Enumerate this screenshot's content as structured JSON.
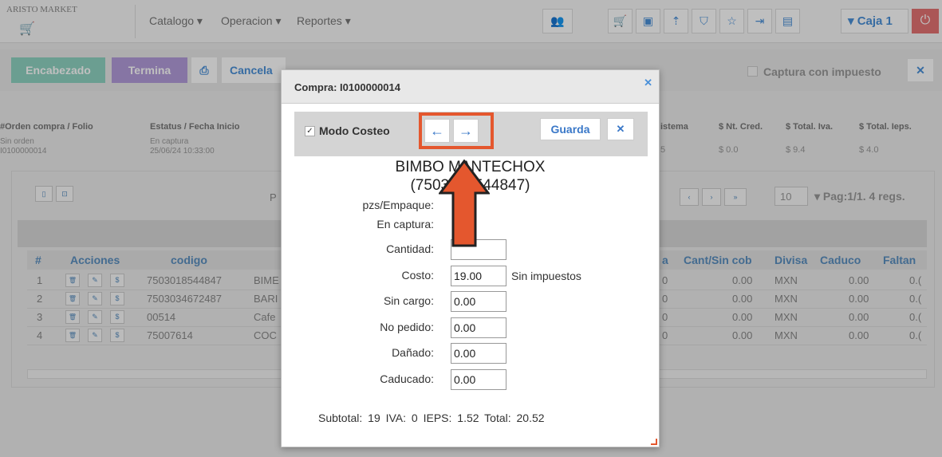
{
  "app": {
    "logo_text": "ARISTO MARKET",
    "menu": [
      "Catalogo ▾",
      "Operacion ▾",
      "Reportes ▾"
    ],
    "caja": "▾ Caja 1"
  },
  "toolbar": {
    "encabezado": "Encabezado",
    "termina": "Termina",
    "cancela": "Cancela",
    "captura": "Captura con impuesto"
  },
  "header": {
    "labels": [
      "#Orden compra / Folio",
      "Estatus / Fecha Inicio",
      "istema",
      "$ Nt. Cred.",
      "$ Total. Iva.",
      "$ Total. Ieps."
    ],
    "orden": [
      "Sin orden",
      "I0100000014"
    ],
    "estatus": [
      "En captura",
      "25/06/24 10:33:00"
    ],
    "vals": [
      "5",
      "$ 0.0",
      "$ 9.4",
      "$ 4.0"
    ]
  },
  "grid": {
    "page_size": "10",
    "page_info": "▾ Pag:1/1. 4 regs.",
    "p_label": "P",
    "columns": [
      "#",
      "Acciones",
      "codigo",
      "a",
      "Cant/Sin cob",
      "Divisa",
      "Caduco",
      "Faltan"
    ],
    "rows": [
      {
        "n": "1",
        "codigo": "7503018544847",
        "desc": "BIME",
        "a": "0",
        "cant": "0.00",
        "divisa": "MXN",
        "caduco": "0.00",
        "faltan": "0.("
      },
      {
        "n": "2",
        "codigo": "7503034672487",
        "desc": "BARI",
        "a": "0",
        "cant": "0.00",
        "divisa": "MXN",
        "caduco": "0.00",
        "faltan": "0.("
      },
      {
        "n": "3",
        "codigo": "00514",
        "desc": "Cafe",
        "a": "0",
        "cant": "0.00",
        "divisa": "MXN",
        "caduco": "0.00",
        "faltan": "0.("
      },
      {
        "n": "4",
        "codigo": "75007614",
        "desc": "COC",
        "a": "0",
        "cant": "0.00",
        "divisa": "MXN",
        "caduco": "0.00",
        "faltan": "0.("
      }
    ]
  },
  "modal": {
    "title": "Compra: I0100000014",
    "modo_costeo": "Modo Costeo",
    "guarda": "Guarda",
    "product_name": "BIMBO MANTECHOX",
    "product_code": "(7503018544847)",
    "pzs_label": "pzs/Empaque:",
    "captura_label": "En captura:",
    "fields": [
      {
        "label": "Cantidad:",
        "value": ""
      },
      {
        "label": "Costo:",
        "value": "19.00"
      },
      {
        "label": "Sin cargo:",
        "value": "0.00"
      },
      {
        "label": "No pedido:",
        "value": "0.00"
      },
      {
        "label": "Dañado:",
        "value": "0.00"
      },
      {
        "label": "Caducado:",
        "value": "0.00"
      }
    ],
    "costo_note": "Sin impuestos",
    "totals": "Subtotal:  19   IVA:   0   IEPS:   1.52   Total:   20.52"
  },
  "colors": {
    "highlight": "#e4572e",
    "accent": "#3a78c8",
    "encabezado": "#8fd3c2",
    "termina": "#b39ddb"
  }
}
